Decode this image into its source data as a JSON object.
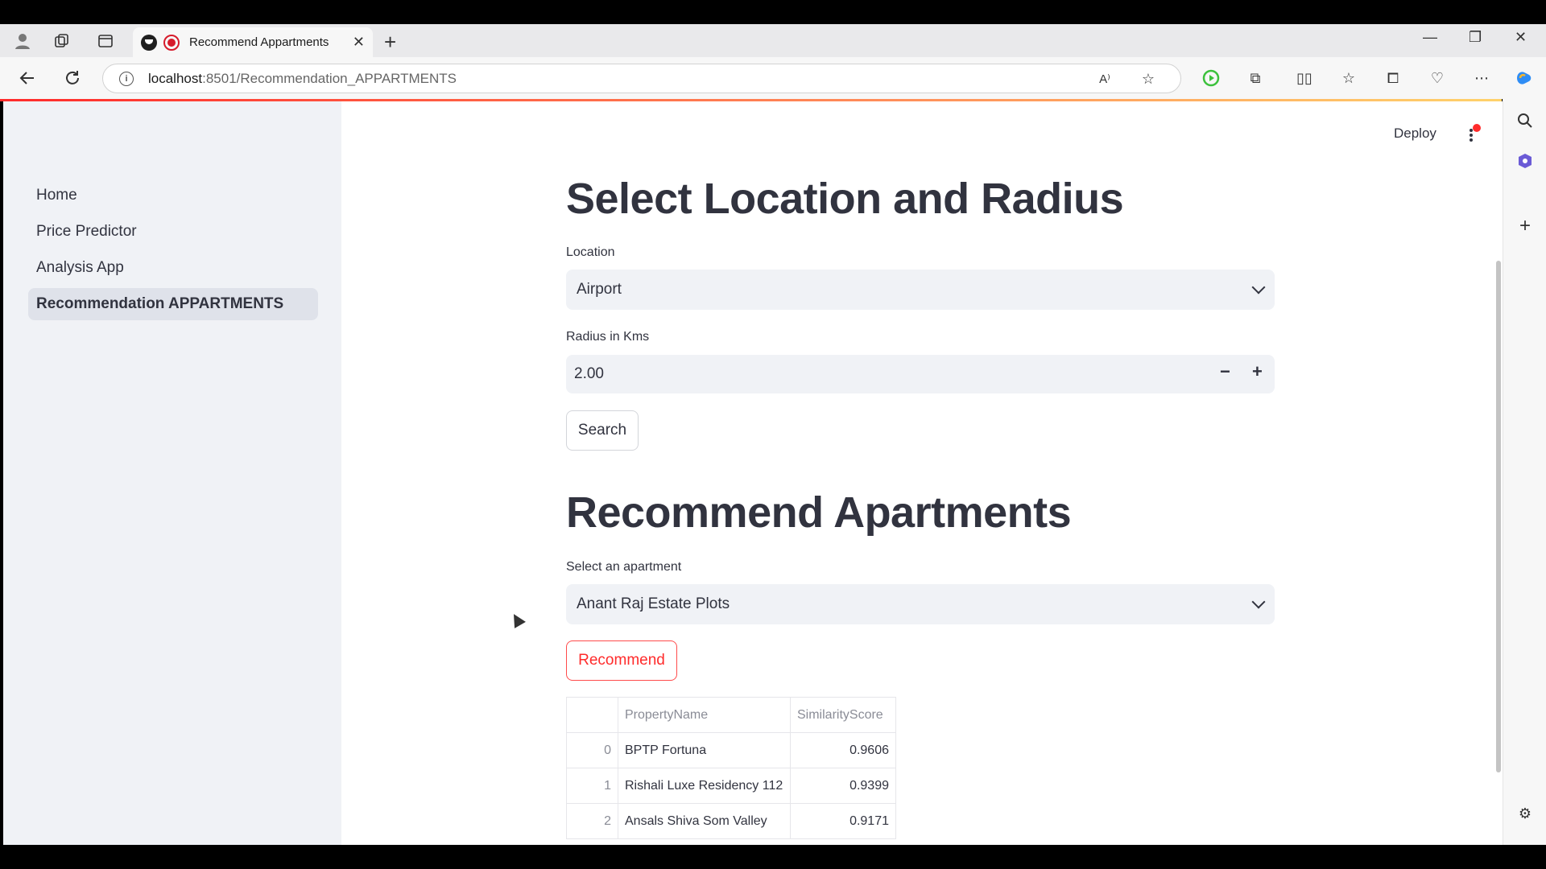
{
  "browser": {
    "tab_title": "Recommend Appartments",
    "url_host": "localhost",
    "url_path": ":8501/Recommendation_APPARTMENTS"
  },
  "sidebar": {
    "items": [
      {
        "label": "Home"
      },
      {
        "label": "Price Predictor"
      },
      {
        "label": "Analysis App"
      },
      {
        "label": "Recommendation APPARTMENTS"
      }
    ]
  },
  "header": {
    "deploy_label": "Deploy"
  },
  "location_section": {
    "title": "Select Location and Radius",
    "location_label": "Location",
    "location_value": "Airport",
    "radius_label": "Radius in Kms",
    "radius_value": "2.00",
    "minus_label": "−",
    "plus_label": "+",
    "search_label": "Search"
  },
  "recommend_section": {
    "title": "Recommend Apartments",
    "select_label": "Select an apartment",
    "select_value": "Anant Raj Estate Plots",
    "recommend_label": "Recommend",
    "table": {
      "columns": [
        "",
        "PropertyName",
        "SimilarityScore"
      ],
      "rows": [
        {
          "idx": "0",
          "name": "BPTP Fortuna",
          "score": "0.9606"
        },
        {
          "idx": "1",
          "name": "Rishali Luxe Residency 112",
          "score": "0.9399"
        },
        {
          "idx": "2",
          "name": "Ansals Shiva Som Valley",
          "score": "0.9171"
        }
      ]
    }
  },
  "colors": {
    "accent": "#ff4b4b",
    "sidebar_bg": "#f0f2f6",
    "text": "#31333f"
  }
}
